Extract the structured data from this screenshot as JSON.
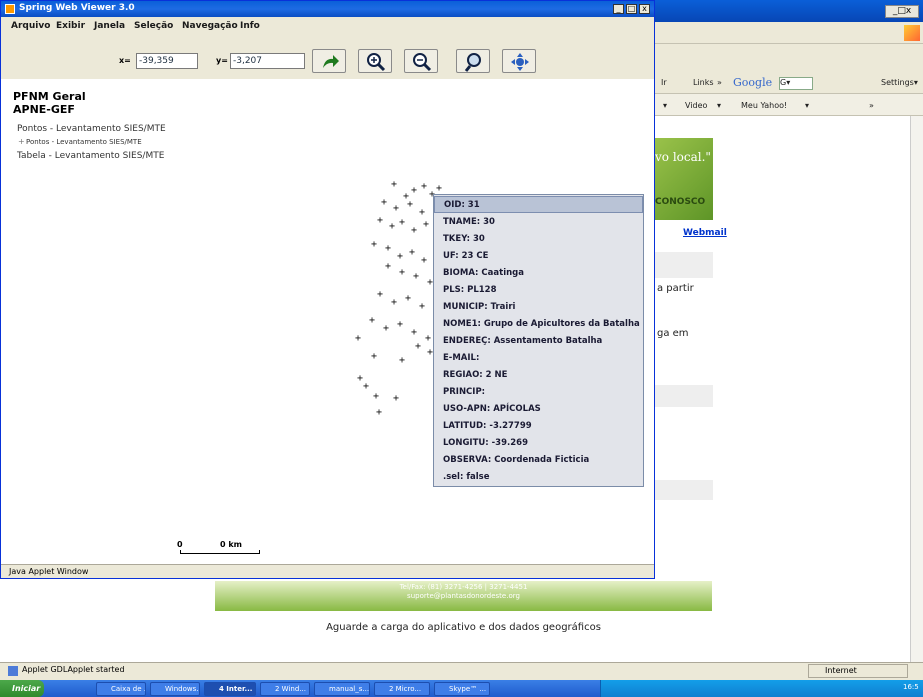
{
  "applet": {
    "title": "Spring Web Viewer 3.0",
    "menu": [
      "Arquivo",
      "Exibir",
      "Janela",
      "Seleção",
      "Navegação",
      "Info"
    ],
    "x_label": "x=",
    "x_value": "-39,359",
    "y_label": "y=",
    "y_value": "-3,207",
    "tool_buttons": [
      "redo-arrow-icon",
      "zoom-in-icon",
      "zoom-out-icon",
      "zoom-tool-icon",
      "pan-icon"
    ],
    "window_buttons": [
      "_",
      "□",
      "x"
    ],
    "status": "Java Applet Window"
  },
  "sidebar": {
    "title": "PFNM Geral",
    "subtitle": "APNE-GEF",
    "items": [
      "Pontos - Levantamento SIES/MTE",
      "Pontos - Levantamento SIES/MTE",
      "Tabela - Levantamento SIES/MTE"
    ]
  },
  "scale": {
    "start": "0",
    "end": "0 km"
  },
  "popup": {
    "rows": [
      "OID: 31",
      "TNAME: 30",
      "TKEY: 30",
      "UF: 23 CE",
      "BIOMA: Caatinga",
      "PLS: PL128",
      "MUNICIP: Trairi",
      "NOME1: Grupo de Apicultores da Batalha",
      "ENDEREÇ: Assentamento Batalha",
      "E-MAIL:",
      "REGIAO: 2 NE",
      "PRINCIP:",
      "USO-APN: APÍCOLAS",
      "LATITUD: -3.27799",
      "LONGITU: -39.269",
      "OBSERVA: Coordenada Ficticia",
      ".sel: false"
    ]
  },
  "browser": {
    "toolbar": [
      "Ir",
      "Links",
      "»",
      "Google",
      "G▾",
      "Settings▾"
    ],
    "toolbar2": [
      "▾",
      "Video",
      "▾",
      "Meu Yahoo!",
      "▾",
      "»"
    ],
    "banner_text": "vo local.\"",
    "conosco": "CONOSCO",
    "webmail": "Webmail",
    "text1": "a partir",
    "text2": "ga em",
    "footer_line1": "Tel/Fax: (81) 3271-4256 | 3271-4451",
    "footer_line2": "suporte@plantasdonordeste.org",
    "wait": "Aguarde a carga do aplicativo e dos dados geográficos",
    "status": "Applet GDLApplet started",
    "zone": "Internet"
  },
  "taskbar": {
    "start": "Iniciar",
    "items": [
      "Caixa de ...",
      "Windows...",
      "4 Inter...",
      "2 Wind...",
      "manual_s...",
      "2 Micro...",
      "Skype™ ..."
    ],
    "clock": "16:5"
  },
  "colors": {
    "titlebar": "#0a5fd8",
    "taskbar": "#245edb",
    "popup_bg": "#e2e4ea",
    "popup_sel": "#b9c3d6"
  }
}
